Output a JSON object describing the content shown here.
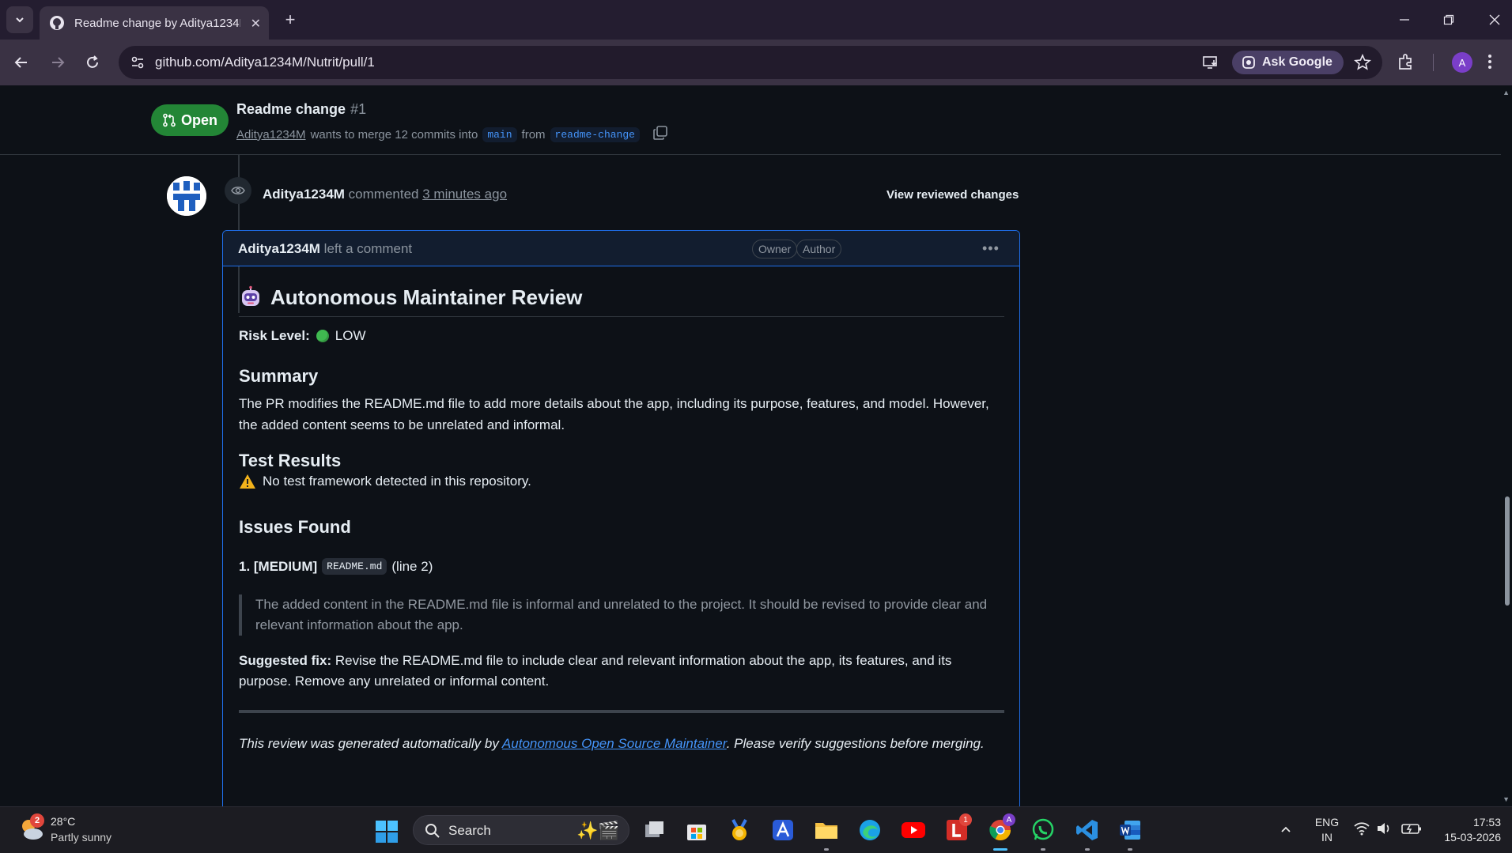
{
  "browser": {
    "tab_title": "Readme change by Aditya1234M",
    "url": "github.com/Aditya1234M/Nutrit/pull/1",
    "ask_google_label": "Ask Google",
    "profile_initial": "A"
  },
  "pr": {
    "state": "Open",
    "title": "Readme change",
    "number": "#1",
    "author": "Aditya1234M",
    "merge_text": "wants to merge 12 commits into",
    "base_branch": "main",
    "from_text": "from",
    "head_branch": "readme-change"
  },
  "event": {
    "author": "Aditya1234M",
    "action": "commented",
    "time": "3 minutes ago",
    "view_changes_label": "View reviewed changes"
  },
  "comment": {
    "author": "Aditya1234M",
    "action": "left a comment",
    "badges": [
      "Owner",
      "Author"
    ],
    "heading": "Autonomous Maintainer Review",
    "risk_label": "Risk Level:",
    "risk_value": "LOW",
    "risk_color": "#3fb950",
    "summary_heading": "Summary",
    "summary_text": "The PR modifies the README.md file to add more details about the app, including its purpose, features, and model. However, the added content seems to be unrelated and informal.",
    "tests_heading": "Test Results",
    "tests_text": "No test framework detected in this repository.",
    "issues_heading": "Issues Found",
    "issue": {
      "prefix": "1. [MEDIUM]",
      "file": "README.md",
      "line": "(line 2)",
      "quote": "The added content in the README.md file is informal and unrelated to the project. It should be revised to provide clear and relevant information about the app."
    },
    "fix_label": "Suggested fix:",
    "fix_text": "Revise the README.md file to include clear and relevant information about the app, its features, and its purpose. Remove any unrelated or informal content.",
    "footer_pre": "This review was generated automatically by",
    "footer_link": "Autonomous Open Source Maintainer",
    "footer_post": ". Please verify suggestions before merging."
  },
  "taskbar": {
    "weather_temp": "28°C",
    "weather_desc": "Partly sunny",
    "weather_badge": "2",
    "search_label": "Search",
    "lastpass_badge": "1",
    "lang_line1": "ENG",
    "lang_line2": "IN",
    "time": "17:53",
    "date": "15-03-2026"
  },
  "colors": {
    "accent": "#1f6feb",
    "link": "#4493f8",
    "open_green": "#238636"
  }
}
